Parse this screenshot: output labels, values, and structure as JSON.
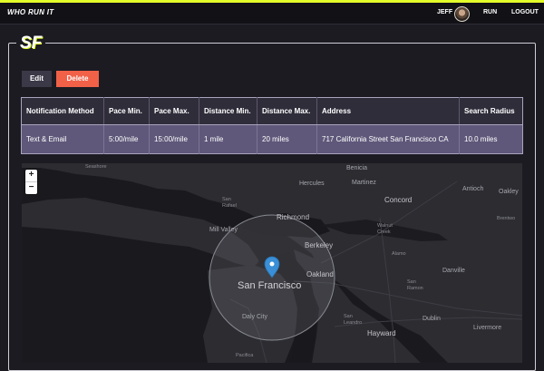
{
  "app": {
    "brand": "WHO RUN IT"
  },
  "nav": {
    "user": "JEFF",
    "run": "RUN",
    "logout": "LOGOUT"
  },
  "page": {
    "title": "SF"
  },
  "actions": {
    "edit": "Edit",
    "delete": "Delete"
  },
  "table": {
    "headers": [
      "Notification Method",
      "Pace Min.",
      "Pace Max.",
      "Distance Min.",
      "Distance Max.",
      "Address",
      "Search Radius"
    ],
    "row": [
      "Text & Email",
      "5:00/mile",
      "15:00/mile",
      "1 mile",
      "20 miles",
      "717 California Street San Francisco CA",
      "10.0 miles"
    ]
  },
  "map": {
    "zoom_in": "+",
    "zoom_out": "−",
    "labels": {
      "seashore": "Seashore",
      "benicia": "Benicia",
      "martinez": "Martinez",
      "hercules": "Hercules",
      "antioch": "Antioch",
      "oakley": "Oakley",
      "concord": "Concord",
      "san_rafael": "San Rafael",
      "richmond": "Richmond",
      "brentwood": "Brentwo",
      "mill_valley": "Mill Valley",
      "walnut_creek": "Walnut Creek",
      "berkeley": "Berkeley",
      "alamo": "Alamo",
      "oakland": "Oakland",
      "san_francisco": "San Francisco",
      "san_ramon": "San Ramon",
      "danville": "Danville",
      "daly_city": "Daly City",
      "san_leandro": "San Leandro",
      "dublin": "Dublin",
      "livermore": "Livermore",
      "hayward": "Hayward",
      "pacifica": "Pacifica"
    }
  },
  "colors": {
    "accent": "#e3ff2a",
    "delete": "#f06148",
    "row_bg": "#5f587a",
    "header_bg": "#302d3b"
  }
}
